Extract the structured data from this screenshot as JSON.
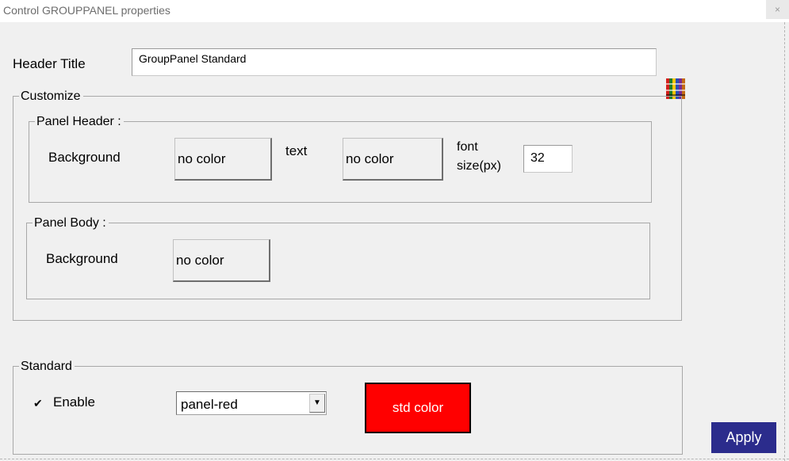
{
  "window": {
    "title": "Control GROUPPANEL properties",
    "close_label": "×"
  },
  "header_title": {
    "label": "Header Title",
    "value": "GroupPanel Standard"
  },
  "customize": {
    "legend": "Customize",
    "palette_icon": "color-palette-icon",
    "panel_header": {
      "legend": "Panel Header :",
      "background_label": "Background",
      "background_button": "no color",
      "text_label": "text",
      "text_button": "no color",
      "font_size_label_1": "font",
      "font_size_label_2": "size(px)",
      "font_size_value": "32"
    },
    "panel_body": {
      "legend": "Panel Body :",
      "background_label": "Background",
      "background_button": "no color"
    }
  },
  "standard": {
    "legend": "Standard",
    "enable_checked_glyph": "✔",
    "enable_label": "Enable",
    "select_value": "panel-red",
    "select_arrow": "▼",
    "std_color_label": "std color"
  },
  "apply_label": "Apply",
  "colors": {
    "std_color": "#ff0000",
    "apply_bg": "#2b2c8c"
  }
}
